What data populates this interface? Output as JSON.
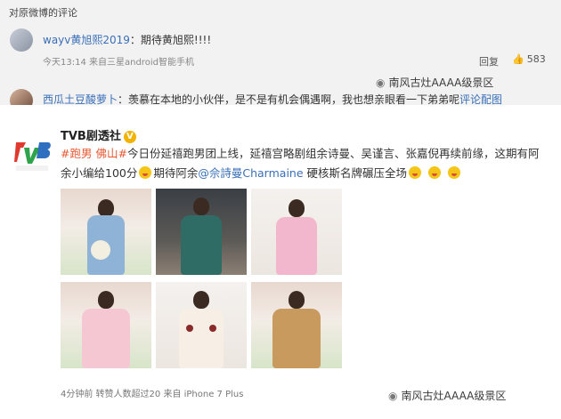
{
  "top_panel": {
    "section_title": "对原微博的评论",
    "comment1": {
      "username": "wayv黄旭熙2019",
      "text": "：期待黄旭熙!!!!",
      "meta": "今天13:14 来自三星android智能手机",
      "reply_label": "回复",
      "like_count": "583"
    },
    "watermark": "南风古灶AAAA级景区",
    "comment2": {
      "username": "西瓜土豆酸萝卜",
      "text": "：羡慕在本地的小伙伴，是不是有机会偶遇啊，我也想亲眼看一下弟弟呢",
      "link": "评论配图"
    }
  },
  "post": {
    "author": "TVB剧透社",
    "verified_mark": "V",
    "tag_pao": "#跑男",
    "tag_foshan": "佛山#",
    "text_a": "今日份延禧跑男团上线，延禧宫略剧组余诗曼、吴谨言、张嘉倪再续前缘，这期有阿余小编给100分",
    "text_b": "期待阿余",
    "mention": "@佘詩曼Charmaine",
    "text_c": "硬核斯名牌碾压全场",
    "meta": "4分钟前 转赞人数超过20 来自 iPhone 7 Plus",
    "watermark": "南风古灶AAAA级景区"
  },
  "icons": {
    "like": "thumbs-up-icon",
    "watermark": "wechat-icon",
    "verified": "verified-badge-icon",
    "emoji": "emoji-icon"
  },
  "colors": {
    "link_blue": "#3a6fb8",
    "tag_orange": "#e8572f",
    "badge_yellow": "#f2b300"
  }
}
